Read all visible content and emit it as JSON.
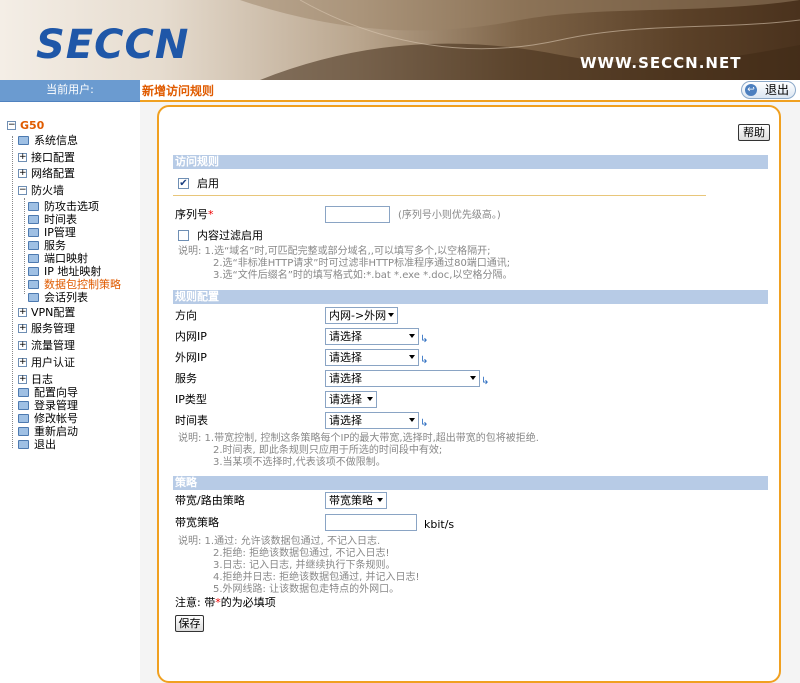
{
  "header": {
    "logo": "SECCN",
    "site_url": "WWW.SECCN.NET"
  },
  "topbar": {
    "user_label": "当前用户:",
    "page_title": "新增访问规则",
    "logout_label": "退出",
    "logout_icon": "arrow-back-icon"
  },
  "sidebar": {
    "root": "G50",
    "items": {
      "sysinfo": "系统信息",
      "iface": "接口配置",
      "network": "网络配置",
      "firewall": "防火墙",
      "fw_anti": "防攻击选项",
      "fw_time": "时间表",
      "fw_ip": "IP管理",
      "fw_service": "服务",
      "fw_portmap": "端口映射",
      "fw_ipmap": "IP 地址映射",
      "fw_packet": "数据包控制策略",
      "fw_session": "会话列表",
      "vpn": "VPN配置",
      "svc_mgmt": "服务管理",
      "traffic": "流量管理",
      "auth": "用户认证",
      "log": "日志",
      "wizard": "配置向导",
      "login": "登录管理",
      "account": "修改帐号",
      "reboot": "重新启动",
      "exit": "退出"
    }
  },
  "form": {
    "help_label": "帮助",
    "section_access": "访问规则",
    "enable_label": "启用",
    "enable_checked": true,
    "seq_label": "序列号",
    "req_mark": "*",
    "seq_value": "",
    "seq_note": "(序列号小则优先级高。)",
    "filter_label": "内容过滤启用",
    "filter_checked": false,
    "note1": [
      "说明: 1.选“域名”时,可匹配完整或部分域名,,可以填写多个,以空格隔开;",
      "2.选“非标准HTTP请求”时可过滤非HTTP标准程序通过80端口通讯;",
      "3.选“文件后缀名”时的填写格式如:*.bat *.exe *.doc,以空格分隔。"
    ],
    "section_rule": "规则配置",
    "direction_label": "方向",
    "direction_value": "内网->外网",
    "inner_ip_label": "内网IP",
    "inner_ip_value": "请选择",
    "outer_ip_label": "外网IP",
    "outer_ip_value": "请选择",
    "service_label": "服务",
    "service_value": "请选择",
    "iptype_label": "IP类型",
    "iptype_value": "请选择",
    "schedule_label": "时间表",
    "schedule_value": "请选择",
    "note2": [
      "说明: 1.带宽控制, 控制这条策略每个IP的最大带宽,选择时,超出带宽的包将被拒绝.",
      "2.时间表, 即此条规则只应用于所选的时间段中有效;",
      "3.当某项不选择时,代表该项不做限制。"
    ],
    "section_policy": "策略",
    "bw_route_label": "带宽/路由策略",
    "bw_route_value": "带宽策略",
    "bw_policy_label": "带宽策略",
    "bw_value": "",
    "bw_unit": "kbit/s",
    "note3": [
      "说明: 1.通过: 允许该数据包通过, 不记入日志.",
      "2.拒绝: 拒绝该数据包通过, 不记入日志!",
      "3.日志: 记入日志, 并继续执行下条规则。",
      "4.拒绝并日志: 拒绝该数据包通过, 并记入日志!",
      "5.外网线路: 让该数据包走特点的外网口。"
    ],
    "required_note_prefix": "注意: 带",
    "required_note_suffix": "的为必填项",
    "save_label": "保存"
  },
  "colors": {
    "accent": "#f0a020",
    "title": "#e05b00",
    "section_bg": "#b7cbe6",
    "sidebar_bar": "#6b9bd0",
    "logo": "#1f57a8"
  }
}
